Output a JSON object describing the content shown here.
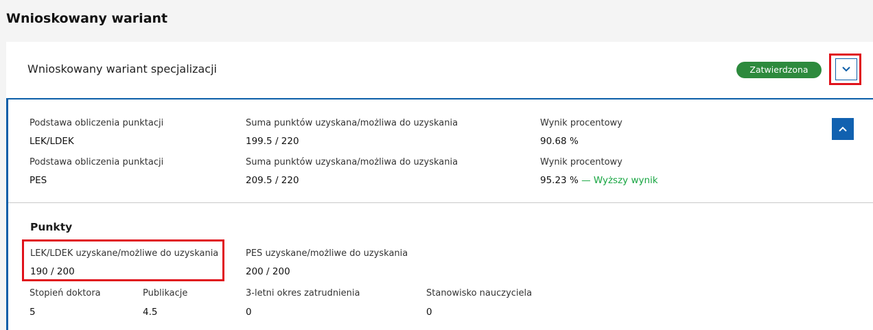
{
  "section_title": "Wnioskowany wariant",
  "card": {
    "title": "Wnioskowany wariant specjalizacji",
    "status": "Zatwierdzona",
    "colors": {
      "accent": "#0b5ea8",
      "status": "#2d8a3d",
      "highlight": "#e0121b",
      "better": "#17a541"
    }
  },
  "scores": [
    {
      "basis_label": "Podstawa obliczenia punktacji",
      "basis_value": "LEK/LDEK",
      "sum_label": "Suma punktów uzyskana/możliwa do uzyskania",
      "sum_value": "199.5 / 220",
      "pct_label": "Wynik procentowy",
      "pct_value": "90.68 %",
      "pct_note": ""
    },
    {
      "basis_label": "Podstawa obliczenia punktacji",
      "basis_value": "PES",
      "sum_label": "Suma punktów uzyskana/możliwa do uzyskania",
      "sum_value": "209.5 / 220",
      "pct_label": "Wynik procentowy",
      "pct_value": "95.23 %",
      "pct_note": "— Wyższy wynik"
    }
  ],
  "points": {
    "title": "Punkty",
    "lek": {
      "label": "LEK/LDEK uzyskane/możliwe do uzyskania",
      "value": "190 / 200"
    },
    "pes": {
      "label": "PES uzyskane/możliwe do uzyskania",
      "value": "200 / 200"
    },
    "doctor": {
      "label": "Stopień doktora",
      "value": "5"
    },
    "publications": {
      "label": "Publikacje",
      "value": "4.5"
    },
    "employment": {
      "label": "3-letni okres zatrudnienia",
      "value": "0"
    },
    "teacher": {
      "label": "Stanowisko nauczyciela",
      "value": "0"
    }
  },
  "icons": {
    "expand": "chevron-down-icon",
    "collapse": "chevron-up-icon"
  }
}
